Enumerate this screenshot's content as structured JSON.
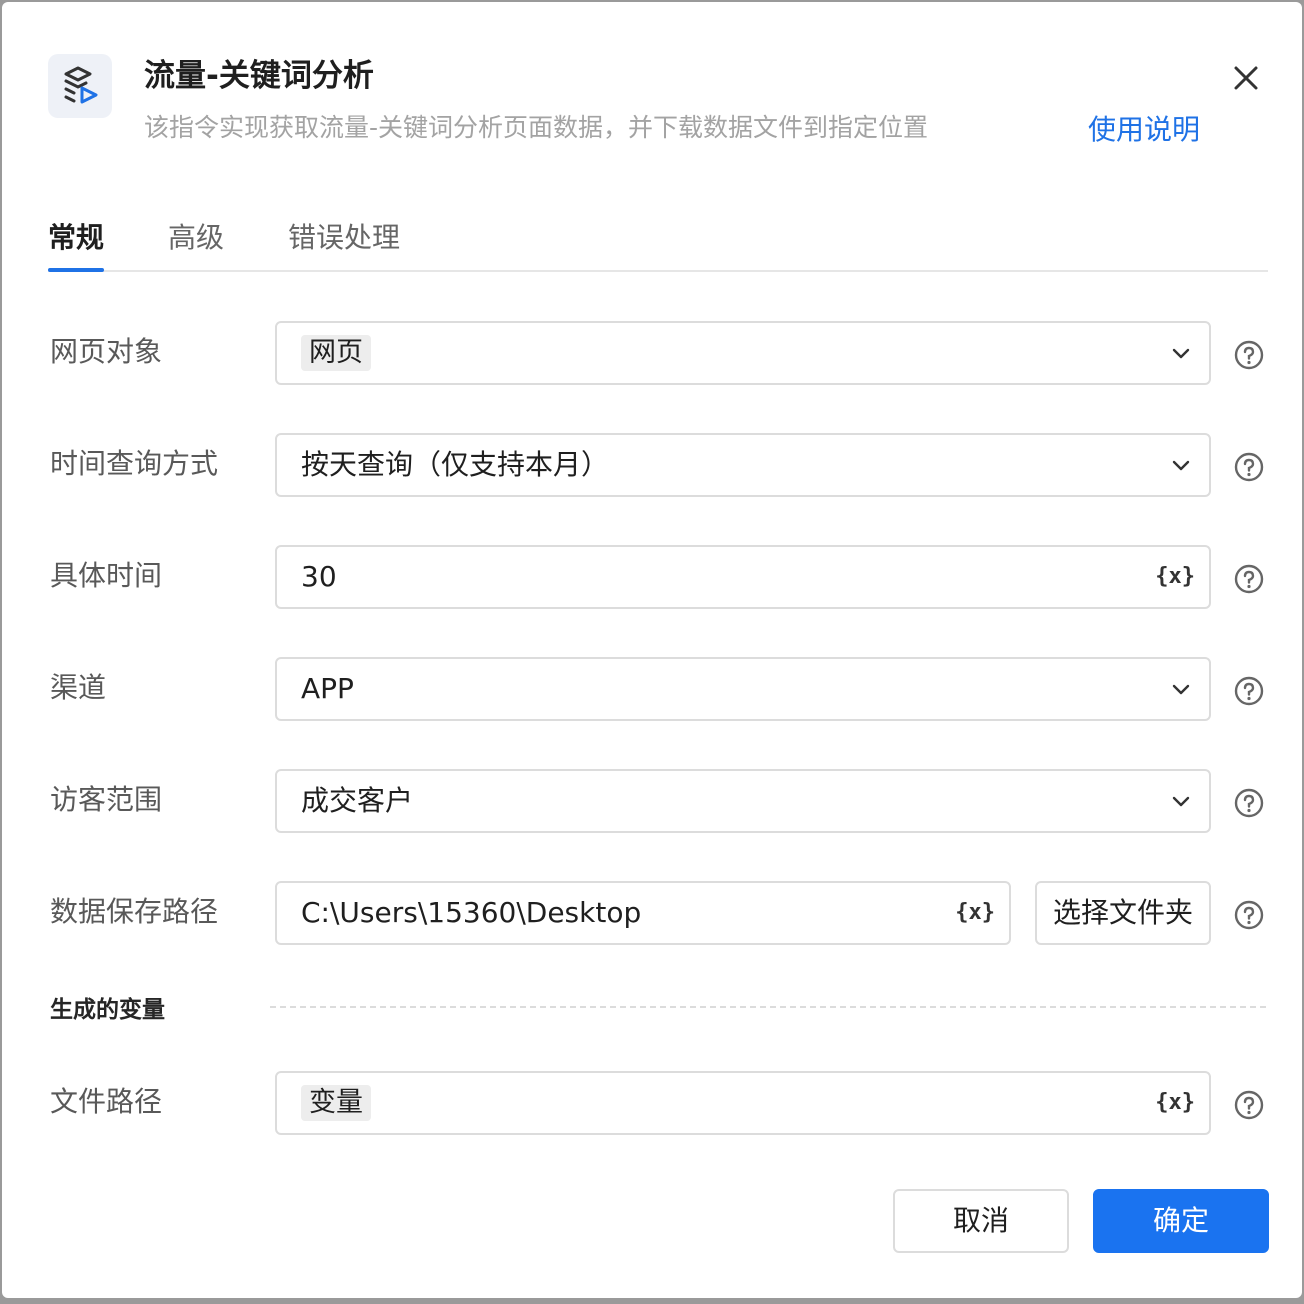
{
  "header": {
    "title": "流量-关键词分析",
    "subtitle": "该指令实现获取流量-关键词分析页面数据，并下载数据文件到指定位置",
    "help_link": "使用说明",
    "icon": "robot-layers-play-icon"
  },
  "tabs": [
    {
      "label": "常规",
      "active": true
    },
    {
      "label": "高级",
      "active": false
    },
    {
      "label": "错误处理",
      "active": false
    }
  ],
  "fields": {
    "web_object": {
      "label": "网页对象",
      "value": "网页"
    },
    "time_query": {
      "label": "时间查询方式",
      "value": "按天查询（仅支持本月）"
    },
    "specific_time": {
      "label": "具体时间",
      "value": "30"
    },
    "channel": {
      "label": "渠道",
      "value": "APP"
    },
    "visitor_range": {
      "label": "访客范围",
      "value": "成交客户"
    },
    "save_path": {
      "label": "数据保存路径",
      "value": "C:\\Users\\15360\\Desktop",
      "button": "选择文件夹"
    }
  },
  "generated": {
    "section_title": "生成的变量",
    "file_path": {
      "label": "文件路径",
      "value": "变量"
    }
  },
  "variable_icon_text": "{x}",
  "footer": {
    "cancel": "取消",
    "ok": "确定"
  },
  "colors": {
    "accent": "#1a73f0",
    "link": "#1f72e6"
  }
}
